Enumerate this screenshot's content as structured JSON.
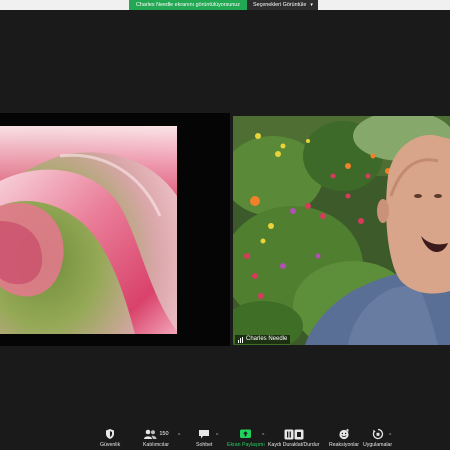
{
  "top_banner": {
    "share_status": "Charles Needle ekranını görüntülüyorsunuz",
    "view_options_label": "Seçenekleri Görüntüle",
    "accent_color": "#22a852"
  },
  "shared_content": {
    "description_icon": "flower-closeup-image"
  },
  "video_tile": {
    "participant_name": "Charles Needle"
  },
  "toolbar": {
    "items": [
      {
        "id": "security",
        "label": "Güvenlik",
        "icon": "shield-icon"
      },
      {
        "id": "participants",
        "label": "Katılımcılar",
        "icon": "people-icon",
        "count": "150"
      },
      {
        "id": "chat",
        "label": "Sohbet",
        "icon": "chat-icon"
      },
      {
        "id": "share",
        "label": "Ekran Paylaşımı",
        "icon": "share-screen-icon",
        "color": "#23d160"
      },
      {
        "id": "record",
        "label": "Kaydı Duraklat/Durdur",
        "icon": "pause-stop-icon"
      },
      {
        "id": "reactions",
        "label": "Reaksiyonlar",
        "icon": "emoji-icon"
      },
      {
        "id": "apps",
        "label": "Uygulamalar",
        "icon": "apps-icon"
      }
    ]
  }
}
